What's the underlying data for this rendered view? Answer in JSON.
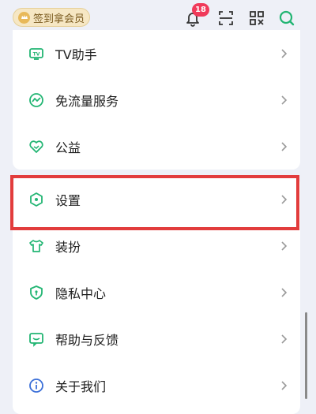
{
  "header": {
    "vip_label": "签到拿会员",
    "notification_count": "18"
  },
  "colors": {
    "accent": "#22b573",
    "highlight": "#e23c3c",
    "badge": "#f03a5a"
  },
  "menu": {
    "tv": {
      "label": "TV助手",
      "icon": "tv-icon"
    },
    "data_free": {
      "label": "免流量服务",
      "icon": "wave-icon"
    },
    "charity": {
      "label": "公益",
      "icon": "heart-icon"
    },
    "settings": {
      "label": "设置",
      "icon": "hexagon-settings-icon"
    },
    "dress_up": {
      "label": "装扮",
      "icon": "shirt-icon"
    },
    "privacy": {
      "label": "隐私中心",
      "icon": "shield-icon"
    },
    "help": {
      "label": "帮助与反馈",
      "icon": "feedback-icon"
    },
    "about": {
      "label": "关于我们",
      "icon": "info-icon"
    }
  }
}
